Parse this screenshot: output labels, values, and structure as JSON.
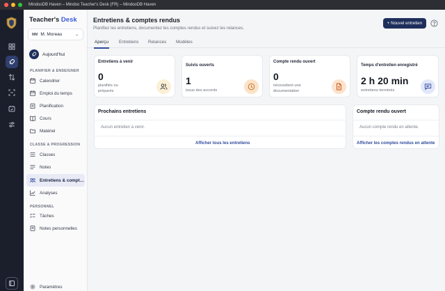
{
  "window": {
    "title": "MindooDB Haven – Mindoo Teacher's Desk (FR) – MindooDB Haven"
  },
  "colors": {
    "accent": "#1f2f5c",
    "rail": "#1b1f2c",
    "link": "#2e4a9c"
  },
  "rail": {
    "icons": [
      "shield-logo",
      "dashboard-icon",
      "rocket-icon",
      "swap-icon",
      "scan-icon",
      "calendar-check-icon",
      "sliders-icon",
      "apps-icon"
    ]
  },
  "sidebar": {
    "brand_a": "Teacher's",
    "brand_b": "Desk",
    "user": {
      "initials": "MM",
      "name": "M. Moreau"
    },
    "today": "Aujourd'hui",
    "sections": [
      "PLANIFIER & ENSEIGNER",
      "CLASSE & PROGRESSION",
      "PERSONNEL"
    ],
    "items_plan": [
      "Calendrier",
      "Emploi du temps",
      "Planification",
      "Cours",
      "Matériel"
    ],
    "items_class": [
      "Classes",
      "Notes",
      "Entretiens & comptes rendus",
      "Analyses"
    ],
    "items_pers": [
      "Tâches",
      "Notes personnelles"
    ],
    "settings": "Paramètres"
  },
  "main": {
    "title": "Entretiens & comptes rendus",
    "subtitle": "Planifiez les entretiens, documentez les comptes rendus et suivez les relances.",
    "new_button": "+ Nouvel entretien",
    "tabs": [
      "Aperçu",
      "Entretiens",
      "Relances",
      "Modèles"
    ],
    "stats": [
      {
        "label": "Entretiens à venir",
        "value": "0",
        "note": "planifiés ou préparés",
        "icon": "people-icon"
      },
      {
        "label": "Suivis ouverts",
        "value": "1",
        "note": "issus des accords",
        "icon": "clock-icon"
      },
      {
        "label": "Compte rendu ouvert",
        "value": "0",
        "note": "nécessitent une documentation",
        "icon": "document-icon"
      },
      {
        "label": "Temps d'entretien enregistré",
        "value": "2 h 20 min",
        "note": "entretiens terminés",
        "icon": "chat-icon"
      }
    ],
    "upcoming": {
      "title": "Prochains entretiens",
      "empty": "Aucun entretien à venir.",
      "link": "Afficher tous les entretiens"
    },
    "open_report": {
      "title": "Compte rendu ouvert",
      "empty": "Aucun compte rendu en attente.",
      "link": "Afficher les comptes rendus en attente"
    }
  }
}
